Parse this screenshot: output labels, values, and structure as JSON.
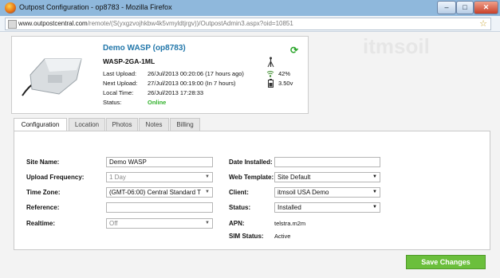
{
  "window": {
    "title": "Outpost Configuration - op8783 - Mozilla Firefox",
    "minimize": "–",
    "maximize": "□",
    "close": "✕"
  },
  "address": {
    "host": "www.outpostcentral.com",
    "path": "/remote/(S(yxgzvojhkbw4k5vmyldtjrgv))/OutpostAdmin3.aspx?oid=10851"
  },
  "background_text": "itmsoil",
  "device": {
    "title": "Demo WASP (op8783)",
    "model": "WASP-2GA-1ML",
    "rows": [
      {
        "label": "Last Upload:",
        "value": "26/Jul/2013 00:20:06 (17 hours ago)"
      },
      {
        "label": "Next Upload:",
        "value": "27/Jul/2013 00:19:00 (In 7 hours)"
      },
      {
        "label": "Local Time:",
        "value": "26/Jul/2013 17:28:33"
      },
      {
        "label": "Status:",
        "value": "Online"
      }
    ],
    "signal": "42%",
    "battery": "3.50v"
  },
  "tabs": [
    "Configuration",
    "Location",
    "Photos",
    "Notes",
    "Billing"
  ],
  "form": {
    "site_name": {
      "label": "Site Name:",
      "value": "Demo WASP"
    },
    "upload_frequency": {
      "label": "Upload Frequency:",
      "value": "1 Day"
    },
    "time_zone": {
      "label": "Time Zone:",
      "value": "(GMT-06:00) Central Standard T"
    },
    "reference": {
      "label": "Reference:",
      "value": ""
    },
    "realtime": {
      "label": "Realtime:",
      "value": "Off"
    },
    "date_installed": {
      "label": "Date Installed:",
      "value": ""
    },
    "web_template": {
      "label": "Web Template:",
      "value": "Site Default"
    },
    "client": {
      "label": "Client:",
      "value": "itmsoil USA Demo"
    },
    "status": {
      "label": "Status:",
      "value": "Installed"
    },
    "apn": {
      "label": "APN:",
      "value": "telstra.m2m"
    },
    "sim_status": {
      "label": "SIM Status:",
      "value": "Active"
    }
  },
  "save_label": "Save Changes",
  "colors": {
    "accent": "#6bbf3c",
    "link": "#2277aa",
    "online": "#31b12b"
  }
}
